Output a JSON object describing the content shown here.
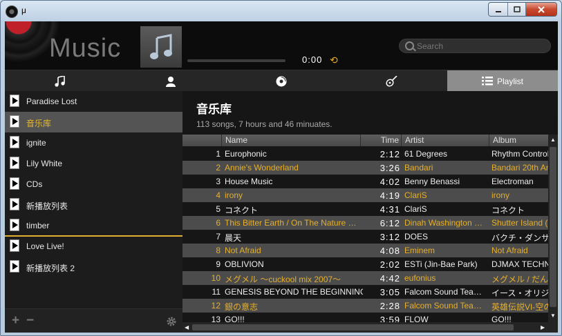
{
  "window": {
    "title": "μ"
  },
  "header": {
    "app_label": "Music",
    "time": "0:00",
    "search_placeholder": "Search"
  },
  "tabs": [
    {
      "icon": "music-note-icon",
      "label": ""
    },
    {
      "icon": "person-icon",
      "label": ""
    },
    {
      "icon": "disc-icon",
      "label": ""
    },
    {
      "icon": "guitar-icon",
      "label": ""
    },
    {
      "icon": "list-icon",
      "label": "Playlist",
      "active": true
    }
  ],
  "playlists": [
    {
      "name": "Paradise Lost"
    },
    {
      "name": "音乐库",
      "selected": true
    },
    {
      "name": "ignite"
    },
    {
      "name": "Lily White"
    },
    {
      "name": "CDs"
    },
    {
      "name": "新播放列表"
    },
    {
      "name": "timber"
    },
    {
      "name": "Love Live!"
    },
    {
      "name": "新播放列表 2"
    }
  ],
  "main": {
    "title": "音乐库",
    "subtitle": "113 songs, 7 hours and 46 minuates."
  },
  "table": {
    "columns": [
      "Name",
      "Time",
      "Artist",
      "Album"
    ],
    "rows": [
      {
        "num": "1",
        "name": "Europhonic",
        "time": "2:12",
        "artist": "61 Degrees",
        "album": "Rhythm Control"
      },
      {
        "num": "2",
        "name": "Annie's Wonderland",
        "time": "3:26",
        "artist": "Bandari",
        "album": "Bandari 20th An"
      },
      {
        "num": "3",
        "name": "House Music",
        "time": "4:02",
        "artist": "Benny Benassi",
        "album": "Electroman"
      },
      {
        "num": "4",
        "name": "irony",
        "time": "4:19",
        "artist": "ClariS",
        "album": "irony"
      },
      {
        "num": "5",
        "name": "コネクト",
        "time": "4:31",
        "artist": "ClariS",
        "album": "コネクト"
      },
      {
        "num": "6",
        "name": "This Bitter Earth / On The Nature …",
        "time": "6:12",
        "artist": "Dinah Washington …",
        "album": "Shutter Island ("
      },
      {
        "num": "7",
        "name": "晨天",
        "time": "3:12",
        "artist": "DOES",
        "album": "バクチ・ダンサ"
      },
      {
        "num": "8",
        "name": "Not Afraid",
        "time": "4:08",
        "artist": "Eminem",
        "album": "Not Afraid"
      },
      {
        "num": "9",
        "name": "OBLIVION",
        "time": "2:02",
        "artist": "ESTi (Jin-Bae Park)",
        "album": "DJMAX TECHNIK"
      },
      {
        "num": "10",
        "name": "メグメル ～cuckool mix 2007～",
        "time": "4:42",
        "artist": "eufonius",
        "album": "メグメル / だん"
      },
      {
        "num": "11",
        "name": "GENESIS BEYOND THE BEGINNING",
        "time": "3:05",
        "artist": "Falcom Sound Tea…",
        "album": "イース・オリジ"
      },
      {
        "num": "12",
        "name": "銀の意志",
        "time": "2:28",
        "artist": "Falcom Sound Tea…",
        "album": "英雄伝説VI-空の"
      },
      {
        "num": "13",
        "name": "GO!!!",
        "time": "3:59",
        "artist": "FLOW",
        "album": "GO!!!"
      }
    ]
  },
  "colors": {
    "accent": "#e3b330",
    "selected_bg": "#545454",
    "alt_row": "#4c4c4c"
  }
}
